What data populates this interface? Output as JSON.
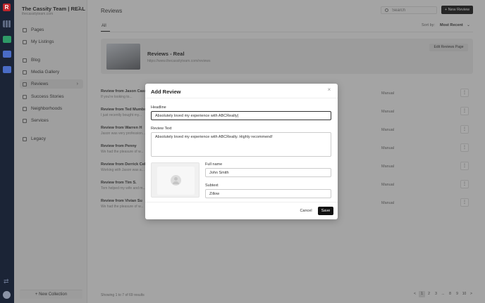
{
  "rail": {
    "logo": "R"
  },
  "sidebar": {
    "brand_title": "The Cassity Team | REAL",
    "brand_subtitle": "thecassityteam.com",
    "items": [
      {
        "label": "Pages",
        "icon": "page-icon"
      },
      {
        "label": "My Listings",
        "icon": "home-icon"
      },
      {
        "label": "Blog",
        "icon": "book-icon"
      },
      {
        "label": "Media Gallery",
        "icon": "image-icon"
      },
      {
        "label": "Reviews",
        "icon": "star-icon",
        "active": true
      },
      {
        "label": "Success Stories",
        "icon": "sparkle-icon"
      },
      {
        "label": "Neighborhoods",
        "icon": "sparkle-icon"
      },
      {
        "label": "Services",
        "icon": "sparkle-icon"
      },
      {
        "label": "Legacy",
        "icon": "history-icon"
      }
    ],
    "new_collection": "+ New Collection"
  },
  "header": {
    "title": "Reviews",
    "search_placeholder": "Search",
    "new_review_label": "+ New Review"
  },
  "tabs": {
    "all": "All"
  },
  "sort": {
    "label": "Sort by:",
    "value": "Most Recent"
  },
  "collection": {
    "title": "Reviews - Real",
    "url": "https://www.thecassityteam.com/reviews",
    "edit_label": "Edit Reviews Page"
  },
  "reviews": [
    {
      "title": "Review from Jason Cassity",
      "sub": "If you're looking to...",
      "source": "Manual"
    },
    {
      "title": "Review from Ted Mumbower",
      "sub": "I just recently bought my...",
      "source": "Manual"
    },
    {
      "title": "Review from Warren H",
      "sub": "Jason was very profession...",
      "source": "Manual"
    },
    {
      "title": "Review from Penny",
      "sub": "We had the pleasure of w...",
      "source": "Manual"
    },
    {
      "title": "Review from Derrick Celus",
      "sub": "Working with Jason was a...",
      "source": "Manual"
    },
    {
      "title": "Review from Tim S.",
      "sub": "Tom helped my wife and m...",
      "source": "Manual"
    },
    {
      "title": "Review from Vivian Su",
      "sub": "We had the pleasure of w...",
      "source": "Manual"
    }
  ],
  "footer": {
    "showing": "Showing 1 to 7 of 69 results",
    "pages": [
      "<",
      "1",
      "2",
      "3",
      "...",
      "8",
      "9",
      "10",
      ">"
    ],
    "active_page": "1"
  },
  "modal": {
    "title": "Add Review",
    "headline_label": "Headline",
    "headline_value": "Absolutely loved my experience with ABCRealty|",
    "review_text_label": "Review Text",
    "review_text_value": "Absolutely loved my experience with ABCRealty. Highly recommend!",
    "full_name_label": "Full name",
    "full_name_value": "John Smith",
    "subtext_label": "Subtext",
    "subtext_value": "Zillow",
    "cancel_label": "Cancel",
    "save_label": "Save"
  }
}
